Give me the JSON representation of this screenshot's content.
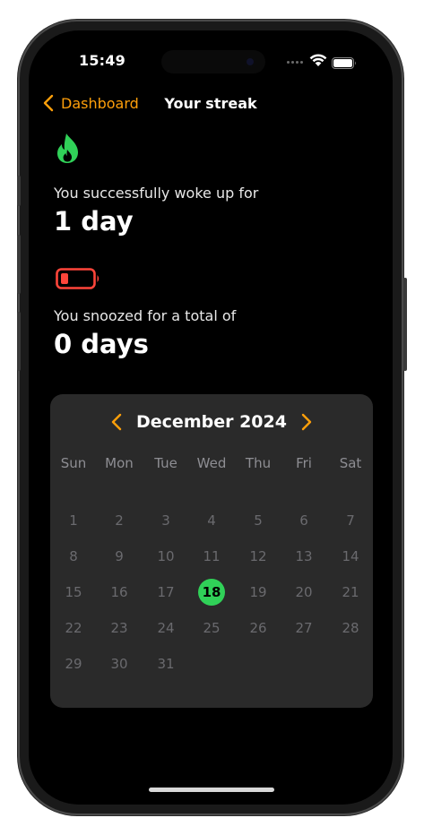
{
  "status_bar": {
    "time": "15:49"
  },
  "nav": {
    "back_label": "Dashboard",
    "title": "Your streak"
  },
  "streak": {
    "woke_label": "You successfully woke up for",
    "woke_value": "1 day",
    "snooze_label": "You snoozed for a total of",
    "snooze_value": "0 days"
  },
  "calendar": {
    "month_label": "December 2024",
    "weekdays": [
      "Sun",
      "Mon",
      "Tue",
      "Wed",
      "Thu",
      "Fri",
      "Sat"
    ],
    "weeks": [
      [
        "",
        "",
        "",
        "",
        "",
        "",
        ""
      ],
      [
        "1",
        "2",
        "3",
        "4",
        "5",
        "6",
        "7"
      ],
      [
        "8",
        "9",
        "10",
        "11",
        "12",
        "13",
        "14"
      ],
      [
        "15",
        "16",
        "17",
        "18",
        "19",
        "20",
        "21"
      ],
      [
        "22",
        "23",
        "24",
        "25",
        "26",
        "27",
        "28"
      ],
      [
        "29",
        "30",
        "31",
        "",
        "",
        "",
        ""
      ]
    ],
    "selected_day": "18"
  },
  "colors": {
    "accent": "#ff9f0a",
    "streak_green": "#30d158",
    "battery_red": "#ff453a",
    "card_bg": "#2a2a2a",
    "muted_day": "#6a6a6e"
  },
  "icons": [
    "flame-icon",
    "battery-low-icon",
    "chevron-left-icon",
    "chevron-right-icon",
    "wifi-icon",
    "battery-icon"
  ]
}
